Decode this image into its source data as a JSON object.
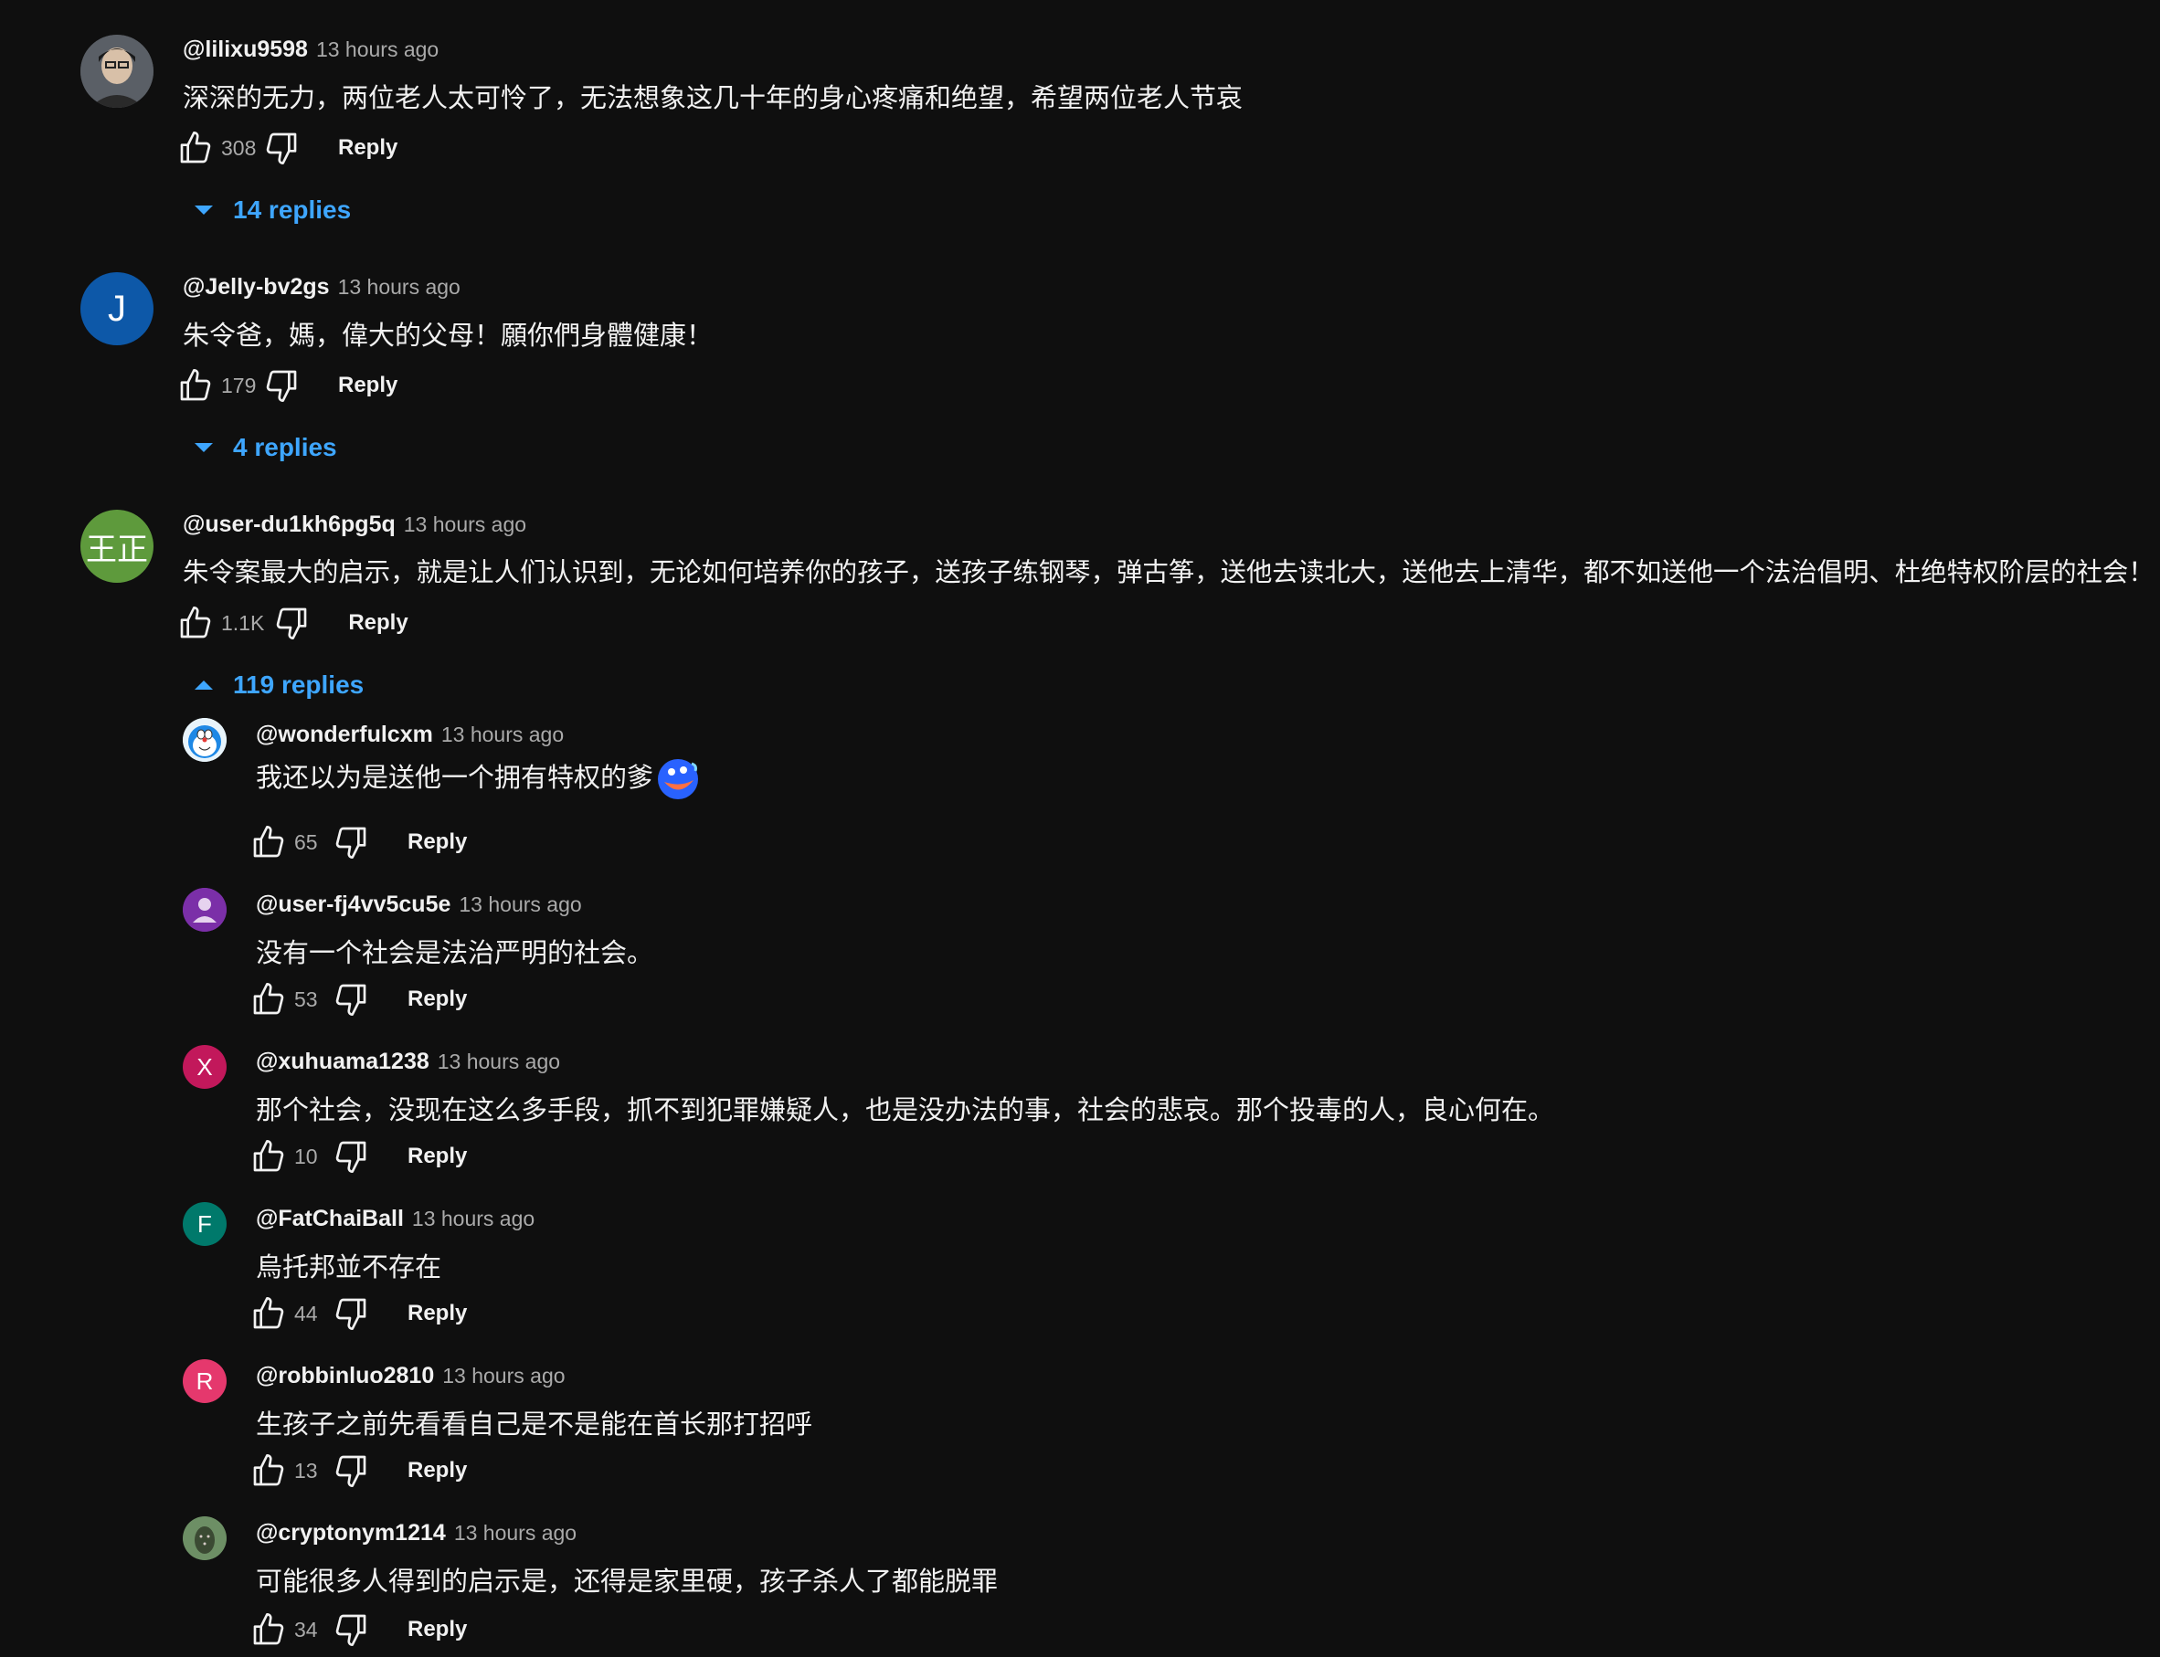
{
  "comments": [
    {
      "handle": "@lilixu9598",
      "time": "13 hours ago",
      "text": "深深的无力，两位老人太可怜了，无法想象这几十年的身心疼痛和绝望，希望两位老人节哀",
      "likes": "308",
      "reply_label": "Reply",
      "replies_toggle": "14 replies",
      "avatar_type": "photo"
    },
    {
      "handle": "@Jelly-bv2gs",
      "time": "13 hours ago",
      "text": "朱令爸，媽，偉大的父母！願你們身體健康！",
      "likes": "179",
      "reply_label": "Reply",
      "replies_toggle": "4 replies",
      "avatar_letter": "J",
      "avatar_color": "#0d58a8"
    },
    {
      "handle": "@user-du1kh6pg5q",
      "time": "13 hours ago",
      "text": "朱令案最大的启示，就是让人们认识到，无论如何培养你的孩子，送孩子练钢琴，弹古筝，送他去读北大，送他去上清华，都不如送他一个法治倡明、杜绝特权阶层的社会！",
      "likes": "1.1K",
      "reply_label": "Reply",
      "replies_toggle": "119 replies",
      "avatar_letter": "王正",
      "avatar_color": "#5e9a3c",
      "replies": [
        {
          "handle": "@wonderfulcxm",
          "time": "13 hours ago",
          "text": "我还以为是送他一个拥有特权的爹",
          "likes": "65",
          "reply_label": "Reply",
          "avatar_type": "doraemon",
          "emoji": "face-emoji"
        },
        {
          "handle": "@user-fj4vv5cu5e",
          "time": "13 hours ago",
          "text": "没有一个社会是法治严明的社会。",
          "likes": "53",
          "reply_label": "Reply",
          "avatar_type": "person",
          "avatar_color": "#7b2fa8"
        },
        {
          "handle": "@xuhuama1238",
          "time": "13 hours ago",
          "text": "那个社会，没现在这么多手段，抓不到犯罪嫌疑人，也是没办法的事，社会的悲哀。那个投毒的人，良心何在。",
          "likes": "10",
          "reply_label": "Reply",
          "avatar_letter": "X",
          "avatar_color": "#c2185b"
        },
        {
          "handle": "@FatChaiBall",
          "time": "13 hours ago",
          "text": "烏托邦並不存在",
          "likes": "44",
          "reply_label": "Reply",
          "avatar_letter": "F",
          "avatar_color": "#00796b"
        },
        {
          "handle": "@robbinluo2810",
          "time": "13 hours ago",
          "text": "生孩子之前先看看自己是不是能在首长那打招呼",
          "likes": "13",
          "reply_label": "Reply",
          "avatar_letter": "R",
          "avatar_color": "#e5386d"
        },
        {
          "handle": "@cryptonym1214",
          "time": "13 hours ago",
          "text": "可能很多人得到的启示是，还得是家里硬，孩子杀人了都能脱罪",
          "likes": "34",
          "reply_label": "Reply",
          "avatar_type": "photo-green"
        }
      ]
    }
  ],
  "colors": {
    "background": "#0f0f0f",
    "text": "#f1f1f1",
    "secondary": "#aaaaaa",
    "link": "#3ea6ff"
  }
}
